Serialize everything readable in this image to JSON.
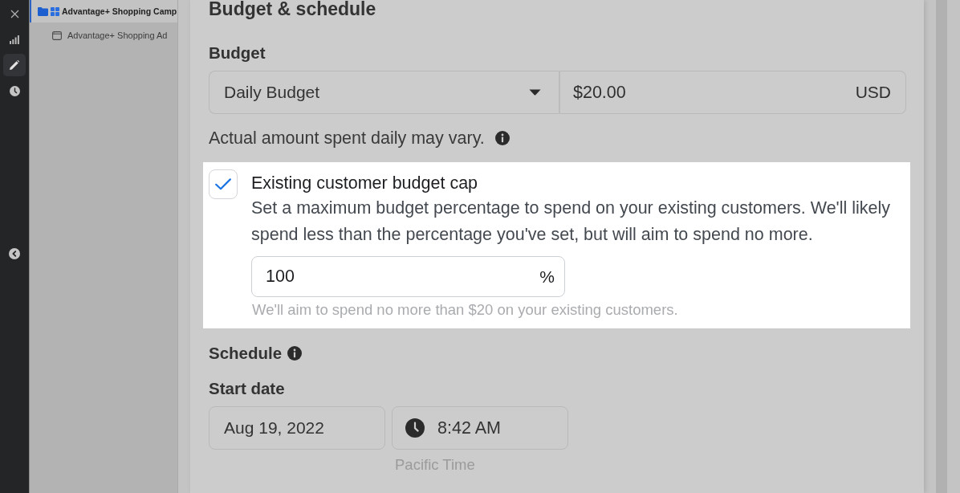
{
  "rail": {
    "items": [
      {
        "kind": "close",
        "selected": false
      },
      {
        "kind": "stats",
        "selected": false
      },
      {
        "kind": "edit",
        "selected": true
      },
      {
        "kind": "history",
        "selected": false
      }
    ]
  },
  "tree": {
    "items": [
      {
        "kind": "campaign",
        "label": "Advantage+ Shopping Camp",
        "selected": true,
        "children": [
          {
            "kind": "ad",
            "label": "Advantage+ Shopping Ad",
            "selected": false
          }
        ]
      }
    ]
  },
  "section": {
    "title": "Budget & schedule"
  },
  "budget": {
    "label": "Budget",
    "type_select": {
      "value": "Daily Budget"
    },
    "amount": {
      "value": "$20.00",
      "currency": "USD"
    },
    "note": "Actual amount spent daily may vary."
  },
  "customer_cap": {
    "highlighted": true,
    "checked": true,
    "title": "Existing customer budget cap",
    "description": "Set a maximum budget percentage to spend on your existing customers. We'll likely spend less than the percentage you've set, but will aim to spend no more.",
    "percent": {
      "value": "100",
      "unit": "%"
    },
    "hint": "We'll aim to spend no more than $20 on your existing customers."
  },
  "schedule": {
    "title": "Schedule",
    "start_label": "Start date",
    "date": {
      "value": "Aug 19, 2022"
    },
    "time": {
      "value": "8:42 AM"
    },
    "timezone": "Pacific Time"
  }
}
